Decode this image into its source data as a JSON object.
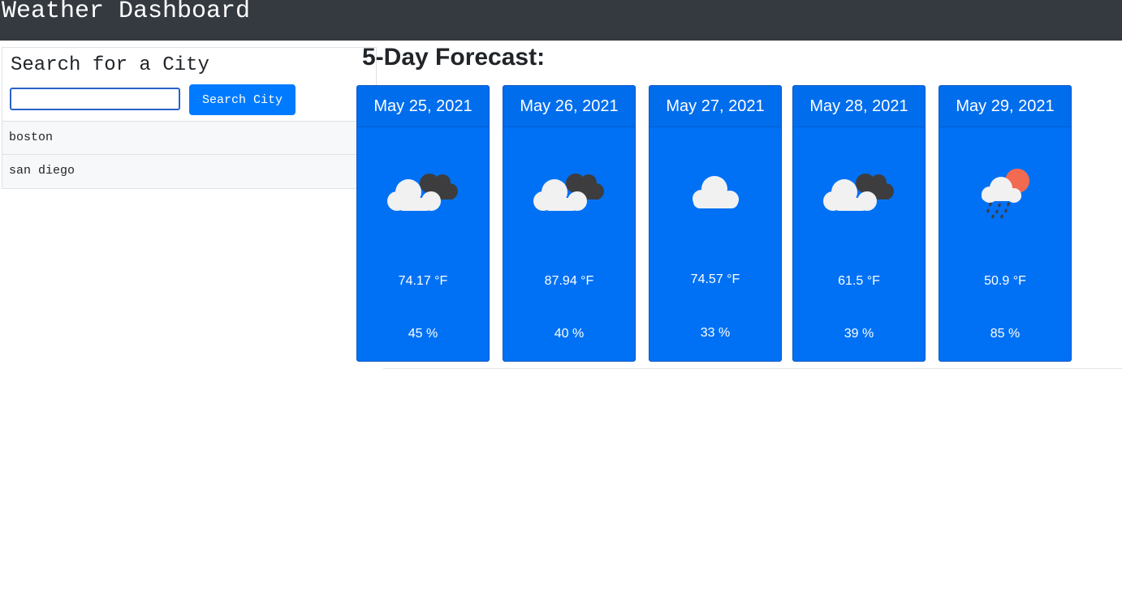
{
  "navbar": {
    "title": "Weather Dashboard"
  },
  "search": {
    "heading": "Search for a City",
    "input_value": "",
    "input_placeholder": "",
    "button_label": "Search City"
  },
  "history": [
    {
      "label": "boston"
    },
    {
      "label": "san diego"
    }
  ],
  "forecast": {
    "title": "5-Day Forecast:",
    "days": [
      {
        "date": "May 25, 2021",
        "icon": "broken-clouds-icon",
        "temp": "74.17 °F",
        "humidity": "45 %"
      },
      {
        "date": "May 26, 2021",
        "icon": "broken-clouds-icon",
        "temp": "87.94 °F",
        "humidity": "40 %"
      },
      {
        "date": "May 27, 2021",
        "icon": "cloud-icon",
        "temp": "74.57 °F",
        "humidity": "33 %"
      },
      {
        "date": "May 28, 2021",
        "icon": "broken-clouds-icon",
        "temp": "61.5 °F",
        "humidity": "39 %"
      },
      {
        "date": "May 29, 2021",
        "icon": "rain-sun-icon",
        "temp": "50.9 °F",
        "humidity": "85 %"
      }
    ]
  },
  "colors": {
    "navbar": "#343a40",
    "primary": "#007bff",
    "card": "#0071f5",
    "cloud": "#f1f1f1",
    "dark_cloud": "#3d3d3f",
    "sun": "#f26a50"
  }
}
